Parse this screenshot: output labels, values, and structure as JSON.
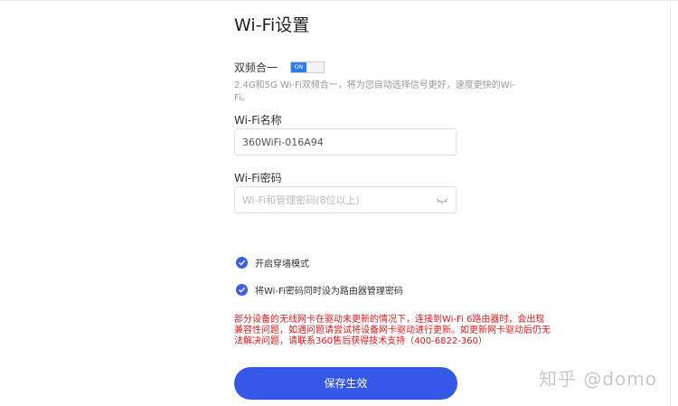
{
  "page": {
    "title": "Wi-Fi设置"
  },
  "dual_band": {
    "label": "双频合一",
    "toggle_state": "ON",
    "description": "2.4G和5G Wi-Fi双频合一，将为您自动选择信号更好，速度更快的Wi-Fi。"
  },
  "wifi_name": {
    "label": "Wi-Fi名称",
    "value": "360WiFi-016A94"
  },
  "wifi_password": {
    "label": "Wi-Fi密码",
    "placeholder": "Wi-Fi和管理密码(8位以上)"
  },
  "options": [
    {
      "label": "开启穿墙模式",
      "checked": true
    },
    {
      "label": "将Wi-Fi密码同时设为路由器管理密码",
      "checked": true
    }
  ],
  "warning": {
    "text": "部分设备的无线网卡在驱动未更新的情况下，连接到Wi-Fi 6路由器时，会出现兼容性问题，如遇问题请尝试将设备网卡驱动进行更新。如更新网卡驱动后仍无法解决问题，请联系360售后获得技术支持（400-6822-360）",
    "color": "#e0181b"
  },
  "save_button": {
    "label": "保存生效",
    "color": "#3558e8"
  },
  "watermark": {
    "text": "知乎 @domo"
  }
}
